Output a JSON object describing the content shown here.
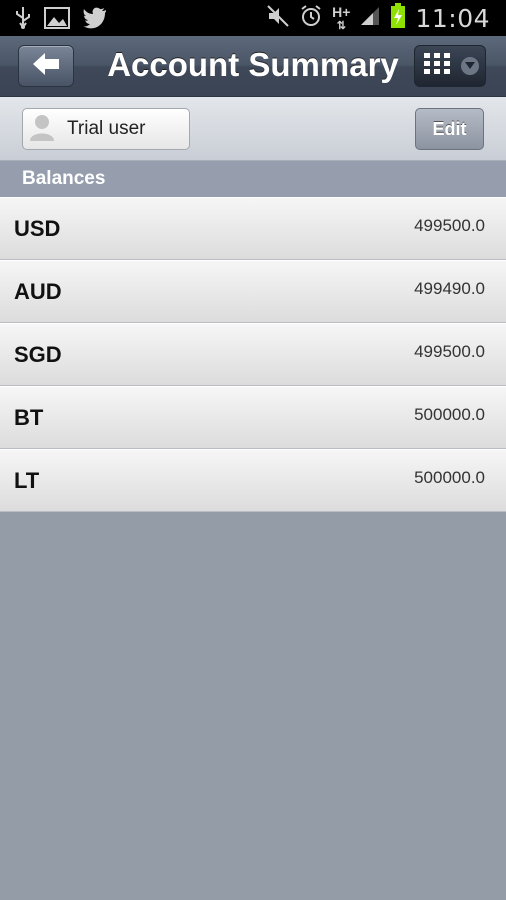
{
  "status_bar": {
    "time": "11:04",
    "icons": [
      "usb-icon",
      "image-icon",
      "twitter-icon",
      "mute-icon",
      "alarm-icon",
      "hplus-data-icon",
      "signal-icon",
      "battery-charging-icon"
    ],
    "network_label": "H+"
  },
  "header": {
    "title": "Account Summary",
    "back_icon": "back-arrow-icon",
    "menu_icon": "grid-menu-icon"
  },
  "toolbar": {
    "user_label": "Trial user",
    "edit_label": "Edit"
  },
  "balances": {
    "section_title": "Balances",
    "rows": [
      {
        "currency": "USD",
        "amount": "499500.0"
      },
      {
        "currency": "AUD",
        "amount": "499490.0"
      },
      {
        "currency": "SGD",
        "amount": "499500.0"
      },
      {
        "currency": "BT",
        "amount": "500000.0"
      },
      {
        "currency": "LT",
        "amount": "500000.0"
      }
    ]
  },
  "colors": {
    "header": "#4a5566",
    "background": "#949ca8",
    "section": "#969ead"
  }
}
